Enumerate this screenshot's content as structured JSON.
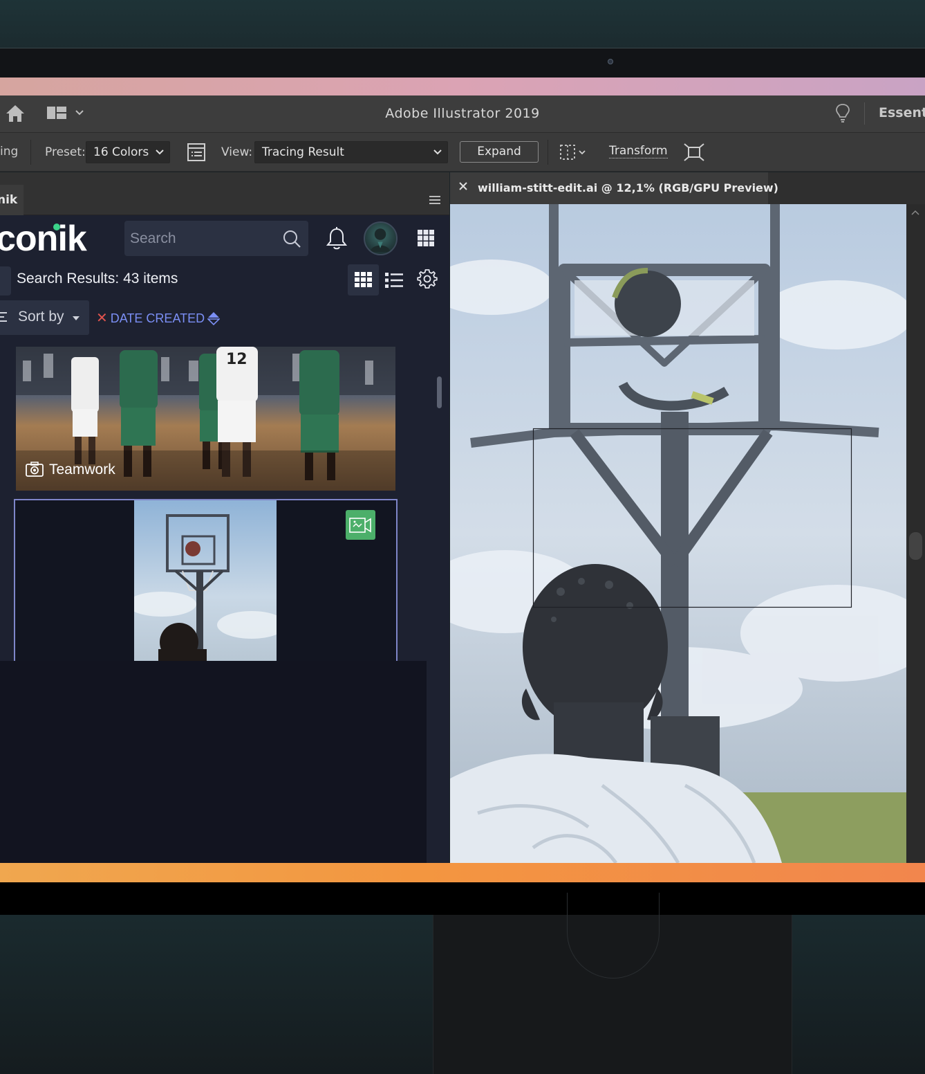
{
  "app": {
    "title": "Adobe Illustrator 2019",
    "workspace_label": "Essent",
    "accent_gradient_top": [
      "#d6a59f",
      "#c9a3c4"
    ],
    "accent_gradient_bottom": [
      "#f0a74f",
      "#f2864d"
    ]
  },
  "controlbar": {
    "left_cut_label": "ing",
    "preset_label": "Preset:",
    "preset_value": "16 Colors",
    "view_label": "View:",
    "view_value": "Tracing Result",
    "expand_label": "Expand",
    "transform_label": "Transform"
  },
  "panel": {
    "tab_label": "nik",
    "brand": "conik",
    "search": {
      "placeholder": "Search"
    },
    "results_label": "Search Results: 43 items",
    "sort": {
      "label": "Sort by",
      "active_filter": "DATE CREATED"
    },
    "assets": [
      {
        "title": "Teamwork",
        "type": "photo-icon"
      },
      {
        "title": "",
        "type": "video-icon"
      }
    ]
  },
  "document": {
    "tab_title": "william-stitt-edit.ai @ 12,1% (RGB/GPU Preview)"
  }
}
